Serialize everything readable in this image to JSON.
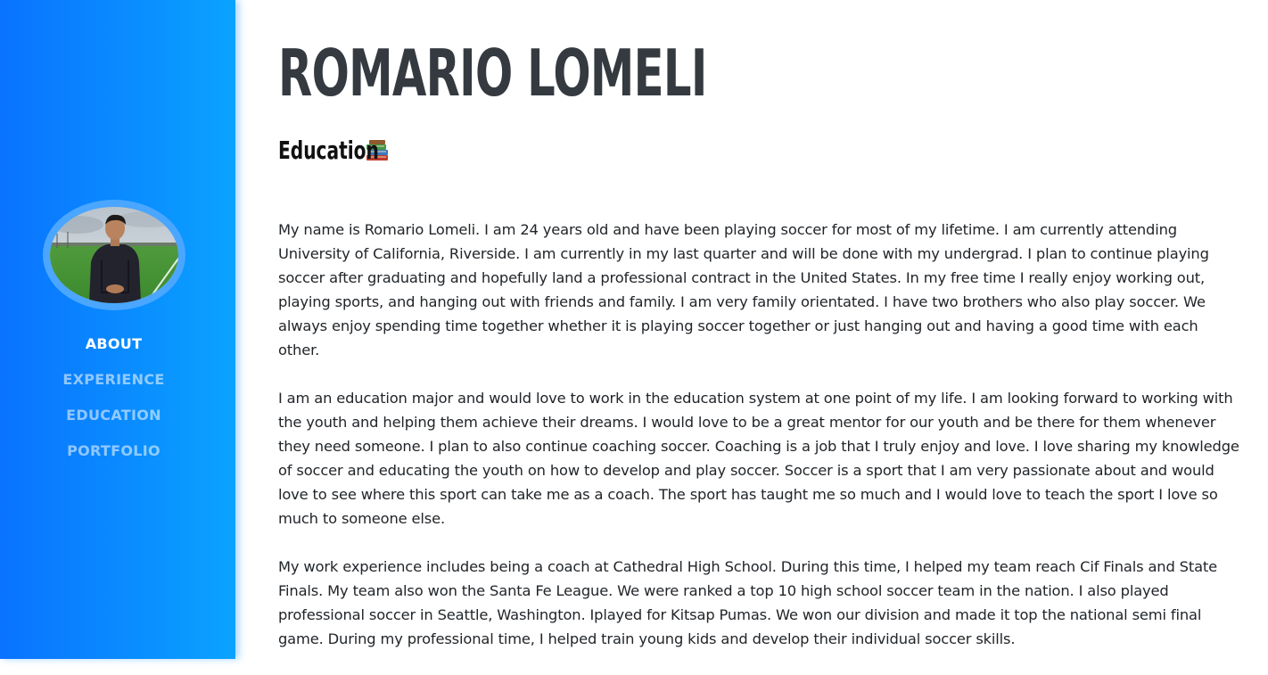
{
  "sidebar": {
    "avatar_alt": "Profile photo",
    "nav": [
      {
        "label": "ABOUT"
      },
      {
        "label": "EXPERIENCE"
      },
      {
        "label": "EDUCATION"
      },
      {
        "label": "PORTFOLIO"
      }
    ],
    "active_index": 0
  },
  "main": {
    "name": "ROMARIO LOMELI",
    "section_title": "Education",
    "section_icon": "books-icon",
    "paragraphs": [
      "My name is Romario Lomeli. I am 24 years old and have been playing soccer for most of my lifetime. I am currently attending University of California, Riverside. I am currently in my last quarter and will be done with my undergrad. I plan to continue playing soccer after graduating and hopefully land a professional contract in the United States. In my free time I really enjoy working out, playing sports, and hanging out with friends and family. I am very family orientated. I have two brothers who also play soccer. We always enjoy spending time together whether it is playing soccer together or just hanging out and having a good time with each other.",
      "I am an education major and would love to work in the education system at one point of my life. I am looking forward to working with the youth and helping them achieve their dreams. I would love to be a great mentor for our youth and be there for them whenever they need someone. I plan to also continue coaching soccer. Coaching is a job that I truly enjoy and love. I love sharing my knowledge of soccer and educating the youth on how to develop and play soccer. Soccer is a sport that I am very passionate about and would love to see where this sport can take me as a coach. The sport has taught me so much and I would love to teach the sport I love so much to someone else.",
      "My work experience includes being a coach at Cathedral High School. During this time, I helped my team reach Cif Finals and State Finals. My team also won the Santa Fe League. We were ranked a top 10 high school soccer team in the nation. I also played professional soccer in Seattle, Washington. Iplayed for Kitsap Pumas. We won our division and made it top the national semi final game. During my professional time, I helped train young kids and develop their individual soccer skills."
    ]
  },
  "colors": {
    "sidebar_start": "#0a73ff",
    "sidebar_end": "#0aa3ff",
    "heading": "#343a40",
    "body_text": "#212529"
  }
}
